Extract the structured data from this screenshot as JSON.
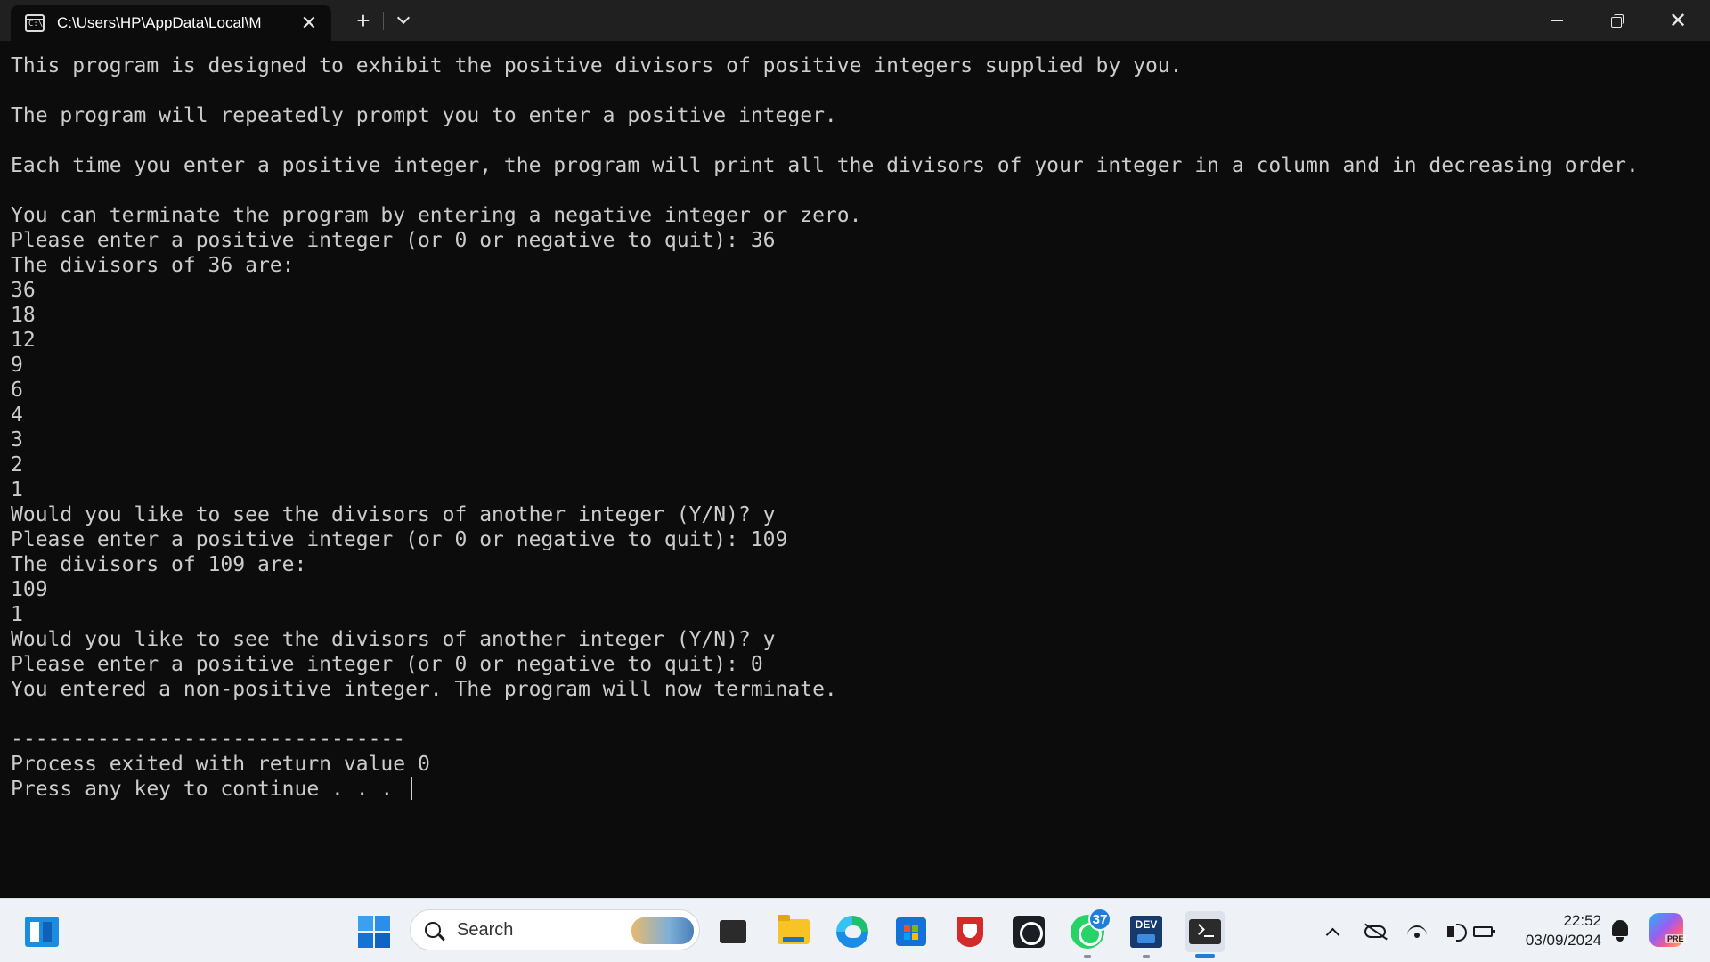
{
  "window": {
    "tab_title": "C:\\Users\\HP\\AppData\\Local\\M",
    "tab_icon_text": "C:\\",
    "new_tab_glyph": "+",
    "close_glyph": "✕",
    "window_close_glyph": "✕"
  },
  "terminal": {
    "lines": [
      "This program is designed to exhibit the positive divisors of positive integers supplied by you.",
      "",
      "The program will repeatedly prompt you to enter a positive integer.",
      "",
      "Each time you enter a positive integer, the program will print all the divisors of your integer in a column and in decreasing order.",
      "",
      "You can terminate the program by entering a negative integer or zero.",
      "Please enter a positive integer (or 0 or negative to quit): 36",
      "The divisors of 36 are:",
      "36",
      "18",
      "12",
      "9",
      "6",
      "4",
      "3",
      "2",
      "1",
      "Would you like to see the divisors of another integer (Y/N)? y",
      "Please enter a positive integer (or 0 or negative to quit): 109",
      "The divisors of 109 are:",
      "109",
      "1",
      "Would you like to see the divisors of another integer (Y/N)? y",
      "Please enter a positive integer (or 0 or negative to quit): 0",
      "You entered a non-positive integer. The program will now terminate.",
      "",
      "--------------------------------",
      "Process exited with return value 0",
      "Press any key to continue . . . "
    ],
    "colors": {
      "background": "#0c0c0c",
      "text": "#cccccc"
    }
  },
  "taskbar": {
    "search_placeholder": "Search",
    "whatsapp_badge": "37",
    "devcpp_label": "DEV",
    "clock_time": "22:52",
    "clock_date": "03/09/2024",
    "copilot_tag": "PRE",
    "icons": [
      "widgets-icon",
      "start-icon",
      "search-icon",
      "tv-app-icon",
      "file-explorer-icon",
      "edge-icon",
      "store-icon",
      "shield-app-icon",
      "github-icon",
      "whatsapp-icon",
      "devcpp-icon",
      "terminal-icon",
      "chevron-up-icon",
      "onedrive-icon",
      "wifi-icon",
      "volume-icon",
      "battery-icon",
      "bell-icon",
      "copilot-icon"
    ],
    "accent": "#1f7fd8"
  }
}
